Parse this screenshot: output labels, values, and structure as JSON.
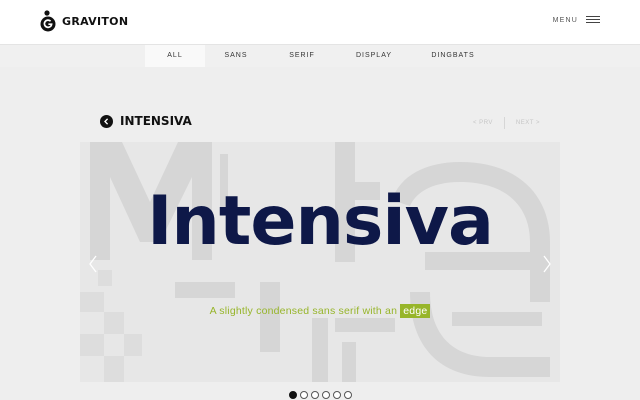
{
  "header": {
    "logo_name": "GRAVITON",
    "menu_label": "MENU"
  },
  "filters": [
    {
      "label": "ALL",
      "active": true
    },
    {
      "label": "SANS",
      "active": false
    },
    {
      "label": "SERIF",
      "active": false
    },
    {
      "label": "DISPLAY",
      "active": false
    },
    {
      "label": "DINGBATS",
      "active": false
    }
  ],
  "font_page": {
    "title": "INTENSIVA",
    "prev_label": "< PRV",
    "next_label": "NEXT >"
  },
  "slide": {
    "font_name": "Intensiva",
    "tagline_prefix": "A slightly condensed sans serif with an",
    "tagline_highlight": "edge"
  },
  "pagination": {
    "total": 6,
    "active_index": 0
  },
  "colors": {
    "accent_green": "#97b52a",
    "title_navy": "#0e1848",
    "background": "#eeeeee"
  },
  "icons": {
    "logo": "graviton-logo-icon",
    "menu": "hamburger-icon",
    "back": "chevron-left-circle-icon",
    "slide_prev": "chevron-left-icon",
    "slide_next": "chevron-right-icon"
  }
}
